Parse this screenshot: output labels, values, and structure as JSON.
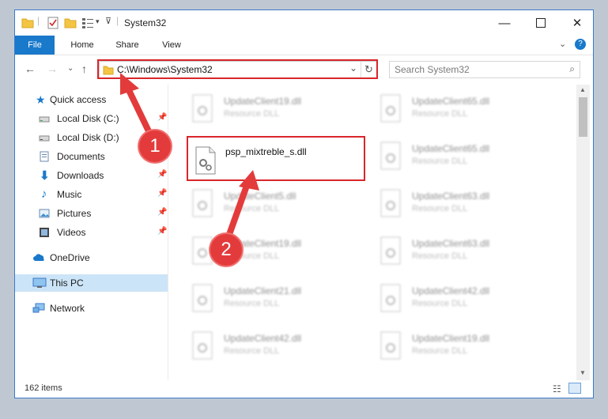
{
  "window": {
    "title": "System32"
  },
  "ribbon": {
    "tabs": [
      "File",
      "Home",
      "Share",
      "View"
    ]
  },
  "address": {
    "path": "C:\\Windows\\System32"
  },
  "search": {
    "placeholder": "Search System32"
  },
  "sidebar": {
    "items": [
      {
        "label": "Quick access",
        "icon": "star-icon"
      },
      {
        "label": "Local Disk (C:)",
        "icon": "drive-icon"
      },
      {
        "label": "Local Disk (D:)",
        "icon": "drive-icon"
      },
      {
        "label": "Documents",
        "icon": "documents-icon"
      },
      {
        "label": "Downloads",
        "icon": "download-icon"
      },
      {
        "label": "Music",
        "icon": "music-icon"
      },
      {
        "label": "Pictures",
        "icon": "pictures-icon"
      },
      {
        "label": "Videos",
        "icon": "videos-icon"
      },
      {
        "label": "OneDrive",
        "icon": "cloud-icon"
      },
      {
        "label": "This PC",
        "icon": "computer-icon"
      },
      {
        "label": "Network",
        "icon": "network-icon"
      }
    ]
  },
  "files": [
    {
      "name": "UpdateClient19.dll",
      "type": "Resource DLL"
    },
    {
      "name": "UpdateClient65.dll",
      "type": "Resource DLL"
    },
    {
      "name": "psp_mixtreble_s.dll",
      "type": ""
    },
    {
      "name": "UpdateClient65.dll",
      "type": "Resource DLL"
    },
    {
      "name": "UpdateClient5.dll",
      "type": "Resource DLL"
    },
    {
      "name": "UpdateClient63.dll",
      "type": "Resource DLL"
    },
    {
      "name": "UpdateClient19.dll",
      "type": "Resource DLL"
    },
    {
      "name": "UpdateClient63.dll",
      "type": "Resource DLL"
    },
    {
      "name": "UpdateClient21.dll",
      "type": "Resource DLL"
    },
    {
      "name": "UpdateClient42.dll",
      "type": "Resource DLL"
    },
    {
      "name": "UpdateClient42.dll",
      "type": "Resource DLL"
    },
    {
      "name": "UpdateClient19.dll",
      "type": "Resource DLL"
    }
  ],
  "status": {
    "item_count": "162 items"
  },
  "annotations": [
    "1",
    "2"
  ],
  "colors": {
    "accent": "#1979ca",
    "highlight": "#d9262b",
    "selected": "#cce4f7"
  }
}
